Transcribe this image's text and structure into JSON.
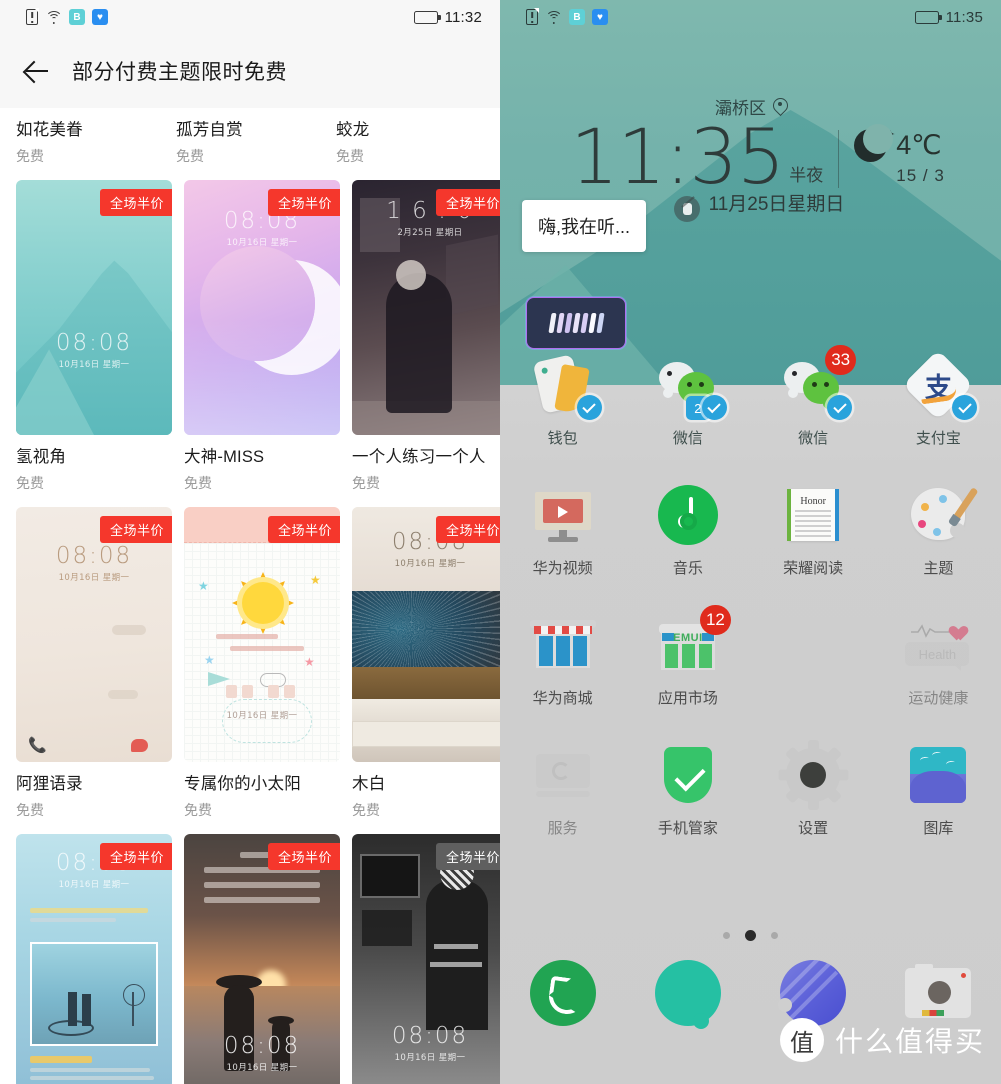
{
  "left": {
    "statusbar": {
      "time": "11:32",
      "icons": [
        "sim-alert-icon",
        "wifi-icon",
        "baidu-badge-icon",
        "bird-badge-icon"
      ]
    },
    "topbar": {
      "back": "back-arrow-icon",
      "title": "部分付费主题限时免费"
    },
    "sale_badge": "全场半价",
    "price_free": "免费",
    "lock_time": "08:08",
    "lock_date": "10月16日 星期一",
    "cafe_time": "1 6 : 0",
    "cafe_date": "2月25日 星期日",
    "rows": [
      {
        "cells": [
          {
            "name": "如花美眷",
            "price": "免费"
          },
          {
            "name": "孤芳自赏",
            "price": "免费"
          },
          {
            "name": "蛟龙",
            "price": "免费"
          }
        ]
      },
      {
        "cells": [
          {
            "name": "氢视角",
            "price": "免费"
          },
          {
            "name": "大神-MISS",
            "price": "免费"
          },
          {
            "name": "一个人练习一个人",
            "price": "免费"
          }
        ]
      },
      {
        "cells": [
          {
            "name": "阿狸语录",
            "price": "免费"
          },
          {
            "name": "专属你的小太阳",
            "price": "免费"
          },
          {
            "name": "木白",
            "price": "免费"
          }
        ]
      }
    ]
  },
  "right": {
    "statusbar": {
      "time": "11:35",
      "icons": [
        "sim-alert-icon",
        "wifi-icon",
        "baidu-badge-icon",
        "bird-badge-icon"
      ]
    },
    "location": "灞桥区",
    "clock": {
      "time": "11:35",
      "ampm": "半夜",
      "date": "11月25日星期日"
    },
    "weather": {
      "temp": "4℃",
      "range": "15 / 3",
      "condition_icon": "moon-icon"
    },
    "assistant_bubble": "嗨,我在听...",
    "app_rows": [
      [
        {
          "label": "钱包",
          "icon": "wallet-icon",
          "badge": null,
          "twin": null,
          "shield": true
        },
        {
          "label": "微信",
          "icon": "wechat-icon",
          "badge": null,
          "twin": "2",
          "shield": true
        },
        {
          "label": "微信",
          "icon": "wechat-icon",
          "badge": "33",
          "twin": null,
          "shield": true
        },
        {
          "label": "支付宝",
          "icon": "alipay-icon",
          "badge": null,
          "twin": null,
          "shield": true
        }
      ],
      [
        {
          "label": "华为视频",
          "icon": "huawei-video-icon",
          "badge": null
        },
        {
          "label": "音乐",
          "icon": "music-icon",
          "badge": null
        },
        {
          "label": "荣耀阅读",
          "icon": "honor-reader-icon",
          "badge": null,
          "book_title": "Honor"
        },
        {
          "label": "主题",
          "icon": "themes-icon",
          "badge": null
        }
      ],
      [
        {
          "label": "华为商城",
          "icon": "huawei-store-icon",
          "badge": null
        },
        {
          "label": "应用市场",
          "icon": "appgallery-icon",
          "badge": "12",
          "brand": "EMUI"
        },
        {
          "label": "",
          "icon": "empty-slot",
          "badge": null
        },
        {
          "label": "运动健康",
          "icon": "health-icon",
          "badge": null,
          "bubble": "Health"
        }
      ],
      [
        {
          "label": "服务",
          "icon": "services-icon",
          "badge": null
        },
        {
          "label": "手机管家",
          "icon": "manager-icon",
          "badge": null
        },
        {
          "label": "设置",
          "icon": "settings-icon",
          "badge": null
        },
        {
          "label": "图库",
          "icon": "gallery-icon",
          "badge": null
        }
      ]
    ],
    "pager": {
      "count": 3,
      "active": 2
    },
    "dock": [
      {
        "label": "",
        "icon": "phone-icon"
      },
      {
        "label": "",
        "icon": "messages-icon"
      },
      {
        "label": "",
        "icon": "browser-icon"
      },
      {
        "label": "",
        "icon": "camera-icon"
      }
    ],
    "watermark": {
      "mark": "值",
      "text": "什么值得买"
    }
  },
  "colors": {
    "sale_red": "#f5372c",
    "badge_red": "#e02b1c",
    "shield_blue": "#2aa3dc",
    "wallpaper_teal": "#7fb8ae",
    "ground_gray": "#cfcfcf"
  }
}
